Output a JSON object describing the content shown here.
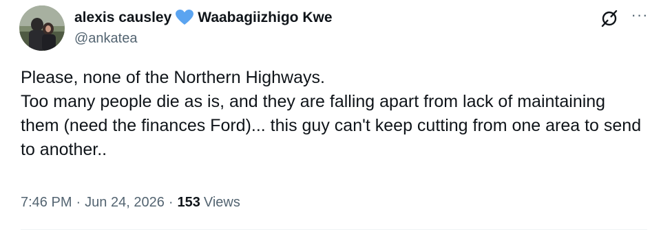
{
  "author": {
    "display_name": "alexis causley",
    "name_suffix": "Waabagiizhigo Kwe",
    "handle": "@ankatea",
    "heart_color": "#5ba4f0"
  },
  "icons": {
    "grok": "grok-icon",
    "more": "more-icon",
    "more_glyph": "···"
  },
  "tweet": {
    "lines": [
      "Please, none of the Northern Highways.",
      "Too many people die as is, and they are falling apart from lack of maintaining them (need the finances Ford)... this guy can't keep cutting from one area to send to another.."
    ]
  },
  "meta": {
    "time": "7:46 PM",
    "separator": "·",
    "date": "Jun 24, 2026",
    "views_count": "153",
    "views_label": "Views"
  },
  "colors": {
    "text": "#0f1419",
    "secondary": "#536471"
  }
}
